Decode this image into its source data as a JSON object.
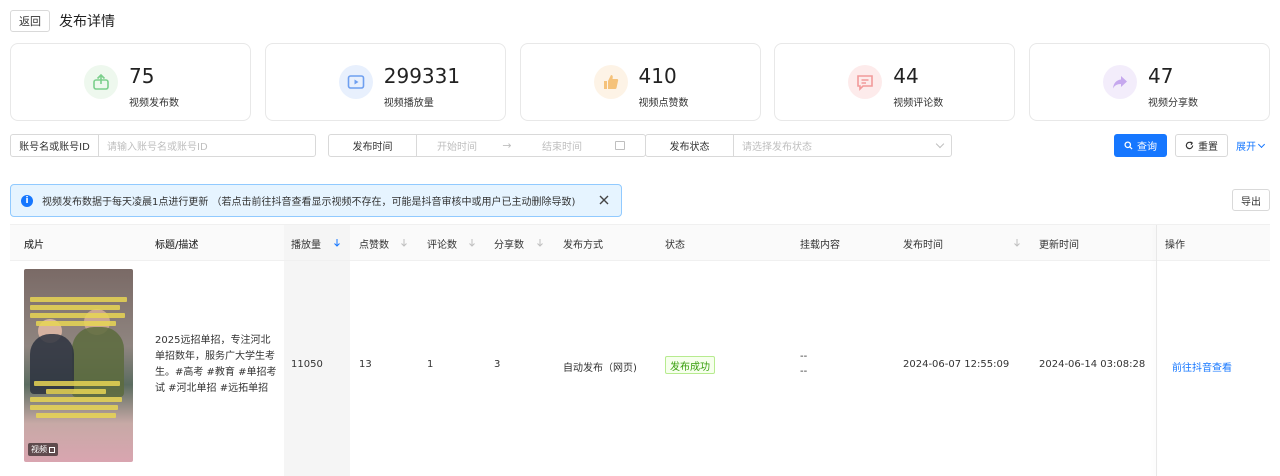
{
  "header": {
    "back_label": "返回",
    "title": "发布详情"
  },
  "stats": [
    {
      "value": "75",
      "label": "视频发布数",
      "icon": "upload-icon",
      "bg": "#eef8ee",
      "fg": "#7ccf8c"
    },
    {
      "value": "299331",
      "label": "视频播放量",
      "icon": "video-play-icon",
      "bg": "#e8f0fd",
      "fg": "#6e9ff0"
    },
    {
      "value": "410",
      "label": "视频点赞数",
      "icon": "thumbs-up-icon",
      "bg": "#fdf3e6",
      "fg": "#f5c27a"
    },
    {
      "value": "44",
      "label": "视频评论数",
      "icon": "comment-icon",
      "bg": "#fdebeb",
      "fg": "#f29a9a"
    },
    {
      "value": "47",
      "label": "视频分享数",
      "icon": "share-icon",
      "bg": "#f3edfb",
      "fg": "#c6a8ee"
    }
  ],
  "filters": {
    "account_label": "账号名或账号ID",
    "account_placeholder": "请输入账号名或账号ID",
    "time_label": "发布时间",
    "start_placeholder": "开始时间",
    "end_placeholder": "结束时间",
    "status_label": "发布状态",
    "status_placeholder": "请选择发布状态",
    "query_label": "查询",
    "reset_label": "重置",
    "expand_label": "展开"
  },
  "notice": {
    "text": "视频发布数据于每天凌晨1点进行更新 （若点击前往抖音查看显示视频不存在，可能是抖音审核中或用户已主动删除导致)"
  },
  "export_label": "导出",
  "table": {
    "columns": [
      "成片",
      "标题/描述",
      "播放量",
      "点赞数",
      "评论数",
      "分享数",
      "发布方式",
      "状态",
      "挂载内容",
      "发布时间",
      "更新时间",
      "操作"
    ],
    "rows": [
      {
        "thumb_badge": "视频",
        "desc": "2025远招单招，专注河北单招数年，服务广大学生考生。#高考 #教育 #单招考试 #河北单招 #远拓单招",
        "plays": "11050",
        "likes": "13",
        "comments": "1",
        "shares": "3",
        "method": "自动发布（网页)",
        "status": "发布成功",
        "mount_line1": "--",
        "mount_line2": "--",
        "publish_time": "2024-06-07 12:55:09",
        "update_time": "2024-06-14 03:08:28",
        "action": "前往抖音查看"
      }
    ]
  },
  "colors": {
    "primary": "#1677ff",
    "success": "#389e0d"
  }
}
